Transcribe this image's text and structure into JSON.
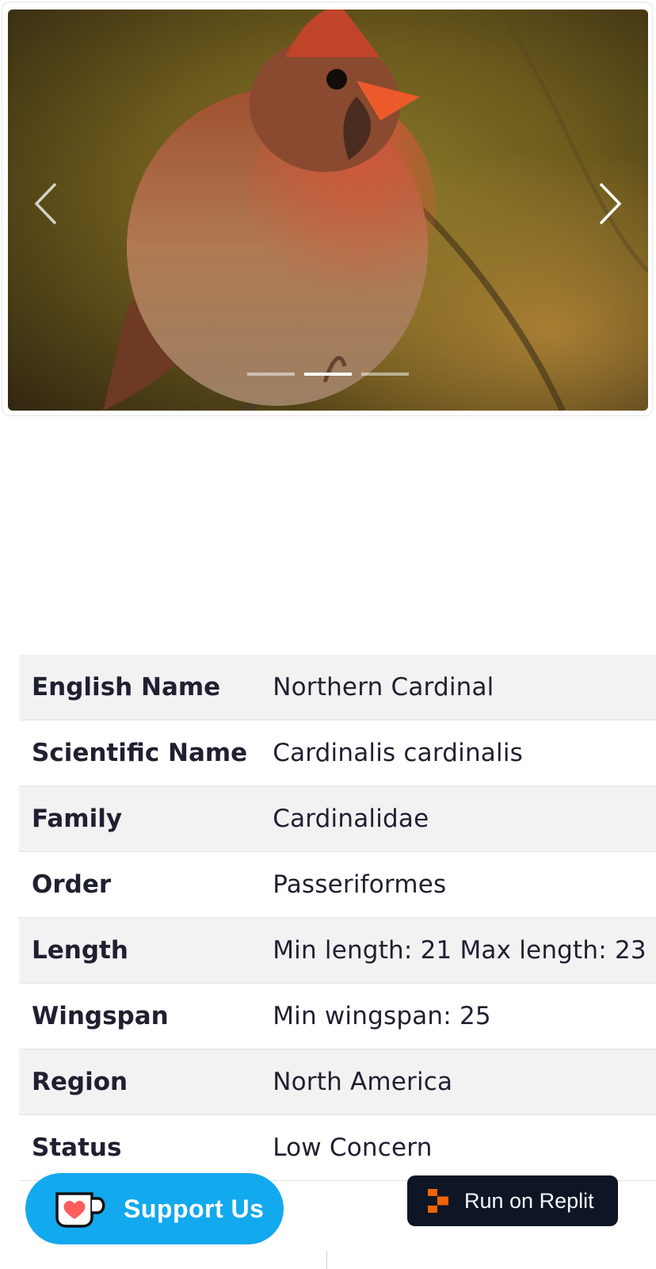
{
  "carousel": {
    "prev_icon": "chevron-left-icon",
    "next_icon": "chevron-right-icon",
    "slide_count": 3,
    "active_slide": 2
  },
  "table": {
    "rows": [
      {
        "label": "English Name",
        "value": "Northern Cardinal"
      },
      {
        "label": "Scientific Name",
        "value": "Cardinalis cardinalis"
      },
      {
        "label": "Family",
        "value": "Cardinalidae"
      },
      {
        "label": "Order",
        "value": "Passeriformes"
      },
      {
        "label": "Length",
        "value": "Min length: 21 Max length: 23"
      },
      {
        "label": "Wingspan",
        "value": "Min wingspan: 25"
      },
      {
        "label": "Region",
        "value": "North America"
      },
      {
        "label": "Status",
        "value": "Low Concern"
      }
    ]
  },
  "support_button": {
    "label": "Support Us",
    "icon": "kofi-cup-icon",
    "color": "#13a9ee"
  },
  "replit_button": {
    "label": "Run on Replit",
    "icon": "replit-logo-icon",
    "color": "#0e1525",
    "accent": "#f26207"
  }
}
